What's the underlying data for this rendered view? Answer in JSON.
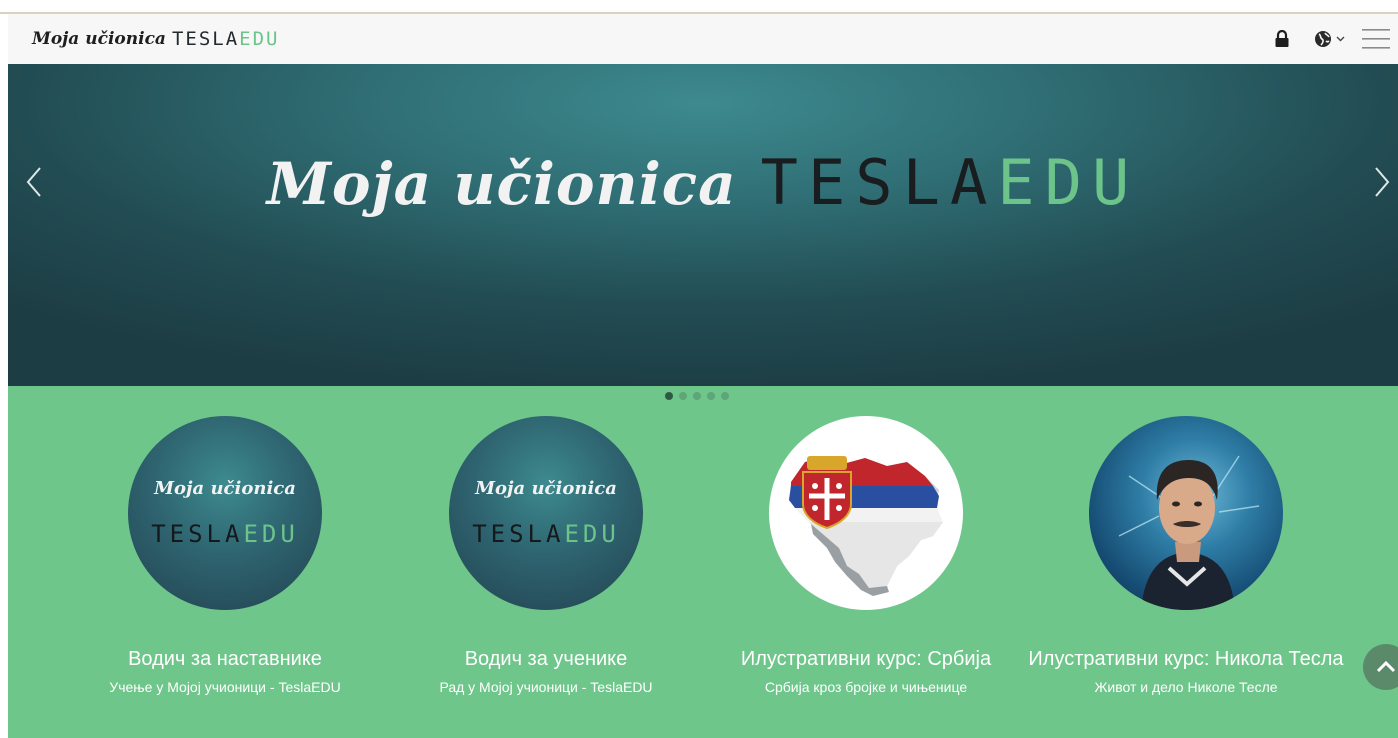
{
  "header": {
    "brand_script": "Moja učionica",
    "brand_tesla_dark": "TESLA",
    "brand_tesla_green": "EDU",
    "icons": [
      "lock-icon",
      "globe-icon",
      "chevron-down-icon",
      "hamburger-menu-icon"
    ]
  },
  "hero": {
    "title_script": "Moja učionica",
    "title_tesla_dark": "TESLA",
    "title_tesla_green": "EDU",
    "slide_count": 5,
    "active_slide": 1
  },
  "courses": [
    {
      "title": "Водич за наставнике",
      "subtitle": "Учење у Мојој учионици - TeslaEDU",
      "image": "logo",
      "logo_script": "Moja učionica",
      "logo_tesla_dark": "TESLA",
      "logo_tesla_green": "EDU"
    },
    {
      "title": "Водич за ученике",
      "subtitle": "Рад у Мојој учионици - TeslaEDU",
      "image": "logo",
      "logo_script": "Moja učionica",
      "logo_tesla_dark": "TESLA",
      "logo_tesla_green": "EDU"
    },
    {
      "title": "Илустративни курс: Србија",
      "subtitle": "Србија кроз бројке и чињенице",
      "image": "serbia-map-flag"
    },
    {
      "title": "Илустративни курс: Никола Тесла",
      "subtitle": "Живот и дело Николе Тесле",
      "image": "nikola-tesla-portrait"
    }
  ],
  "colors": {
    "accent_green": "#6ec68b",
    "hero_teal": "#2f6e74",
    "logo_green": "#6cc48a"
  }
}
